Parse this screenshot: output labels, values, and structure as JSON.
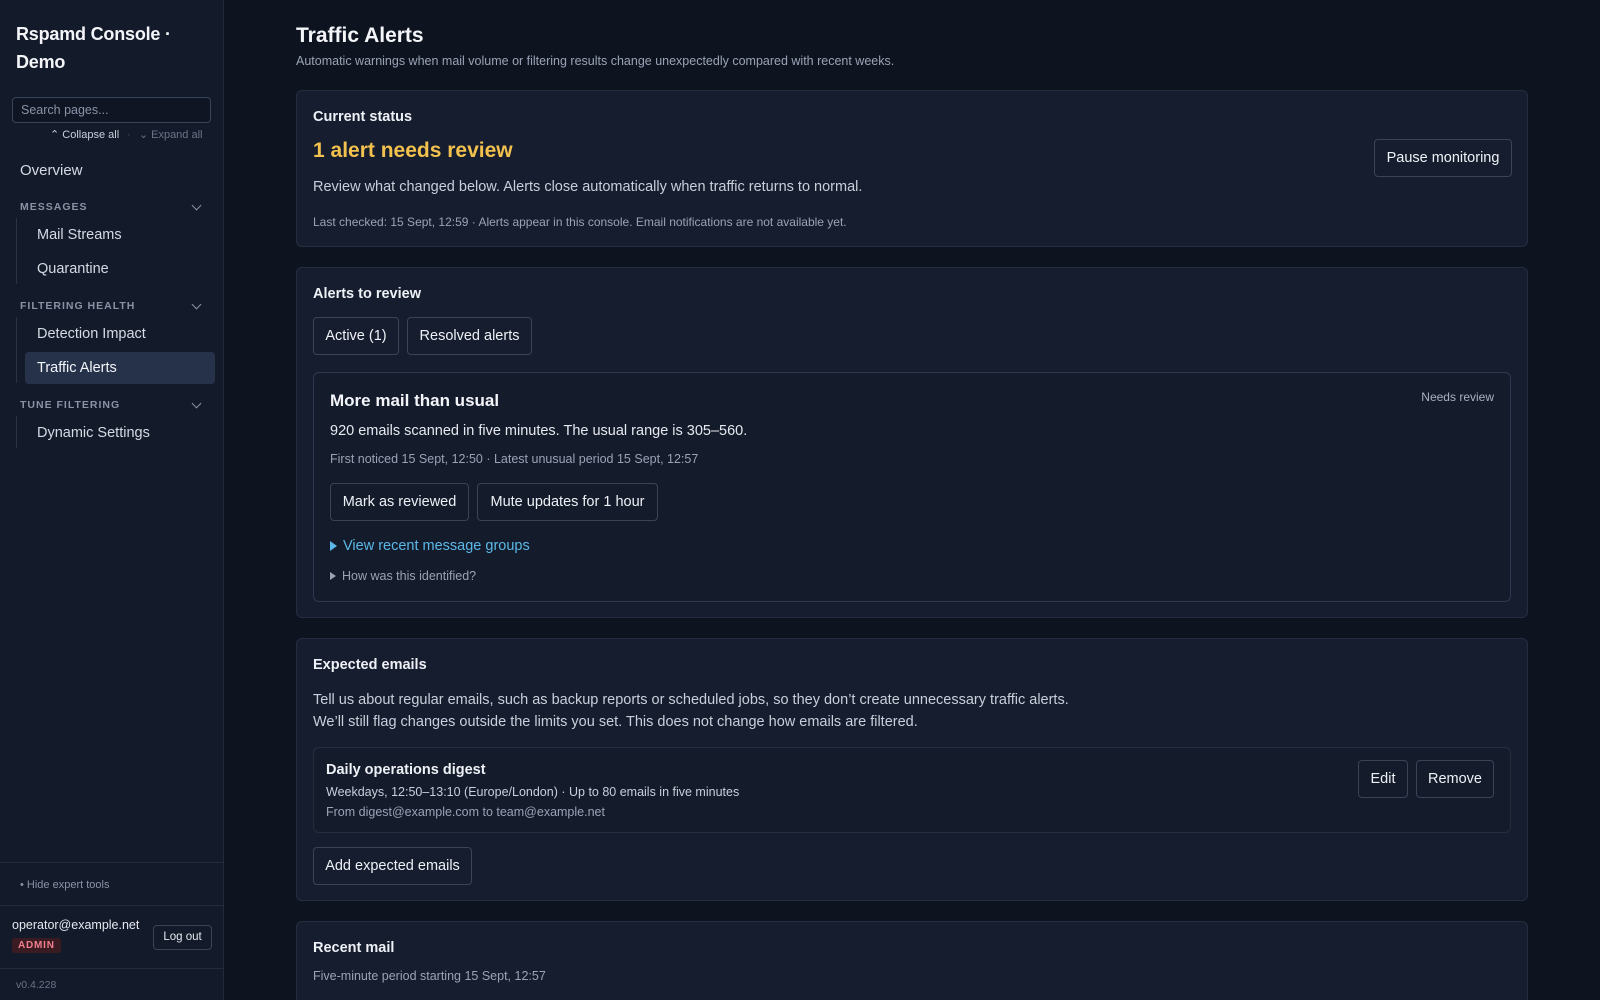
{
  "sidebar": {
    "brand": "Rspamd Console · Demo",
    "search_placeholder": "Search pages...",
    "collapse_all": "Collapse all",
    "separator": "·",
    "expand_all": "Expand all",
    "overview": "Overview",
    "groups": [
      {
        "title": "MESSAGES",
        "items": [
          "Mail Streams",
          "Quarantine"
        ]
      },
      {
        "title": "FILTERING HEALTH",
        "items": [
          "Detection Impact",
          "Traffic Alerts"
        ]
      },
      {
        "title": "TUNE FILTERING",
        "items": [
          "Dynamic Settings"
        ]
      }
    ],
    "active_item": "Traffic Alerts",
    "hide_expert": "• Hide expert tools",
    "user_email": "operator@example.net",
    "user_role": "ADMIN",
    "logout": "Log out",
    "version": "v0.4.228"
  },
  "page": {
    "title": "Traffic Alerts",
    "subtitle": "Automatic warnings when mail volume or filtering results change unexpectedly compared with recent weeks."
  },
  "status_card": {
    "title": "Current status",
    "headline": "1 alert needs review",
    "text": "Review what changed below. Alerts close automatically when traffic returns to normal.",
    "meta": "Last checked: 15 Sept, 12:59 · Alerts appear in this console. Email notifications are not available yet.",
    "pause_button": "Pause monitoring",
    "headline_color": "#f2c14e"
  },
  "alerts_card": {
    "title": "Alerts to review",
    "tabs": [
      "Active (1)",
      "Resolved alerts"
    ],
    "alert": {
      "title": "More mail than usual",
      "badge": "Needs review",
      "text": "920 emails scanned in five minutes. The usual range is 305–560.",
      "meta": "First noticed 15 Sept, 12:50 · Latest unusual period 15 Sept, 12:57",
      "mark_reviewed": "Mark as reviewed",
      "mute": "Mute updates for 1 hour",
      "view_groups": "View recent message groups",
      "how_identified": "How was this identified?"
    }
  },
  "expected_card": {
    "title": "Expected emails",
    "text_line1": "Tell us about regular emails, such as backup reports or scheduled jobs, so they don’t create unnecessary traffic alerts.",
    "text_line2": "We’ll still flag changes outside the limits you set. This does not change how emails are filtered.",
    "item": {
      "name": "Daily operations digest",
      "schedule": "Weekdays, 12:50–13:10 (Europe/London) · Up to 80 emails in five minutes",
      "from": "From digest@example.com to team@example.net",
      "edit": "Edit",
      "remove": "Remove"
    },
    "add_button": "Add expected emails"
  },
  "recent_card": {
    "title": "Recent mail",
    "subtitle": "Five-minute period starting 15 Sept, 12:57"
  }
}
